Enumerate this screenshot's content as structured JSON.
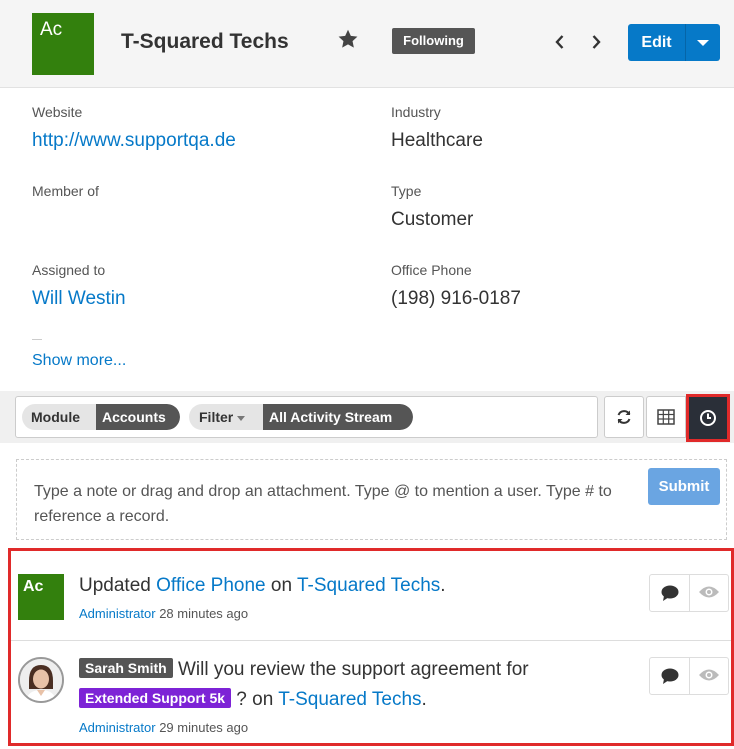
{
  "header": {
    "avatar_initials": "Ac",
    "title": "T-Squared Techs",
    "following_label": "Following",
    "edit_label": "Edit"
  },
  "fields": {
    "website": {
      "label": "Website",
      "value": "http://www.supportqa.de"
    },
    "industry": {
      "label": "Industry",
      "value": "Healthcare"
    },
    "member_of": {
      "label": "Member of",
      "value": ""
    },
    "type": {
      "label": "Type",
      "value": "Customer"
    },
    "assigned_to": {
      "label": "Assigned to",
      "value": "Will Westin"
    },
    "office_phone": {
      "label": "Office Phone",
      "value": "(198) 916-0187"
    }
  },
  "show_more_label": "Show more...",
  "toolbar": {
    "module_key": "Module",
    "module_value": "Accounts",
    "filter_key": "Filter",
    "filter_value": "All Activity Stream"
  },
  "composer": {
    "placeholder": "Type a note or drag and drop an attachment. Type @ to mention a user. Type # to reference a record.",
    "submit_label": "Submit"
  },
  "activities": [
    {
      "avatar_initials": "Ac",
      "prefix": "Updated ",
      "field_link": "Office Phone",
      "middle": " on ",
      "record_link": "T-Squared Techs",
      "suffix": ".",
      "author": "Administrator",
      "time": "28 minutes ago"
    },
    {
      "user_tag": "Sarah Smith",
      "text": " Will you review the support agreement for",
      "record_tag": "Extended Support 5k",
      "middle": " ? on ",
      "record_link": "T-Squared Techs",
      "suffix": ".",
      "author": "Administrator",
      "time": "29 minutes ago"
    }
  ],
  "colors": {
    "brand_blue": "#0679c8",
    "account_green": "#33800d",
    "highlight_red": "#e02a2a",
    "record_tag_purple": "#7d23d6"
  },
  "icons": {
    "star": "star-icon",
    "prev": "chevron-left-icon",
    "next": "chevron-right-icon",
    "edit_menu": "caret-down-icon",
    "refresh": "refresh-icon",
    "table": "table-icon",
    "history": "clock-icon",
    "comment": "comment-icon",
    "preview": "eye-icon"
  }
}
